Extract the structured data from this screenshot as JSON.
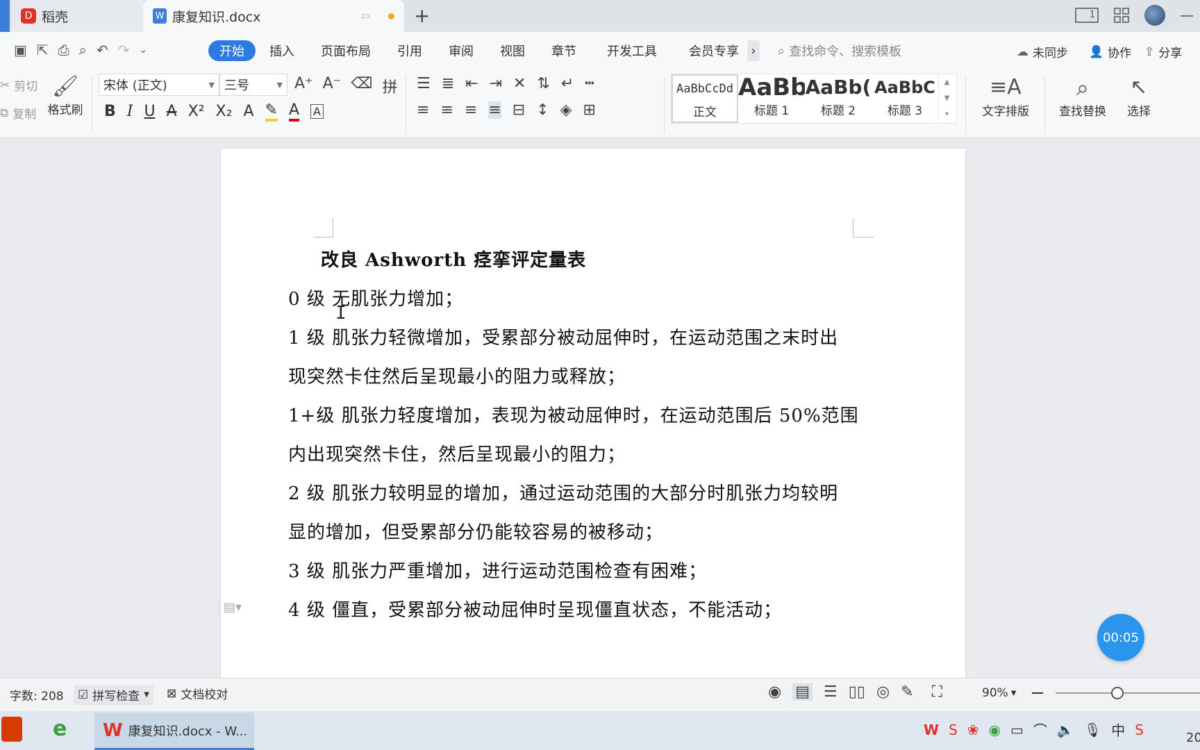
{
  "tabs": {
    "tab1_label": "稻壳",
    "tab2_label": "康复知识.docx",
    "new_tab": "+"
  },
  "titlebar": {
    "page_indicator": "1"
  },
  "menu": {
    "items": [
      "开始",
      "插入",
      "页面布局",
      "引用",
      "审阅",
      "视图",
      "章节",
      "开发工具",
      "会员专享"
    ],
    "more": "›",
    "search_placeholder": "查找命令、搜索模板",
    "sync": "未同步",
    "collab": "协作",
    "share": "分享"
  },
  "ribbon": {
    "cut": "剪切",
    "copy": "复制",
    "format_painter": "格式刷",
    "font_name": "宋体 (正文)",
    "font_size": "三号",
    "styles": [
      {
        "preview": "AaBbCcDd",
        "label": "正文"
      },
      {
        "preview": "AaBb",
        "label": "标题 1"
      },
      {
        "preview": "AaBb(",
        "label": "标题 2"
      },
      {
        "preview": "AaBbC",
        "label": "标题 3"
      }
    ],
    "text_layout": "文字排版",
    "find_replace": "查找替换",
    "select": "选择"
  },
  "document": {
    "title": "改良 Ashworth 痉挛评定量表",
    "lines": [
      "0 级  无肌张力增加；",
      "1 级  肌张力轻微增加，受累部分被动屈伸时，在运动范围之末时出",
      "现突然卡住然后呈现最小的阻力或释放；",
      "1+级  肌张力轻度增加，表现为被动屈伸时，在运动范围后 50%范围",
      "内出现突然卡住，然后呈现最小的阻力；",
      "2 级  肌张力较明显的增加，通过运动范围的大部分时肌张力均较明",
      "显的增加，但受累部分仍能较容易的被移动；",
      "3 级  肌张力严重增加，进行运动范围检查有困难；",
      "4 级  僵直，受累部分被动屈伸时呈现僵直状态，不能活动；"
    ]
  },
  "timer": "00:05",
  "status": {
    "word_count": "字数: 208",
    "spell_check": "拼写检查",
    "doc_proof": "文档校对",
    "zoom": "90%"
  },
  "taskbar": {
    "app_label": "康复知识.docx - W...",
    "ime": "中",
    "clock_partial": "20"
  },
  "colors": {
    "accent": "#2d7be0",
    "wps_red": "#e0322a"
  }
}
